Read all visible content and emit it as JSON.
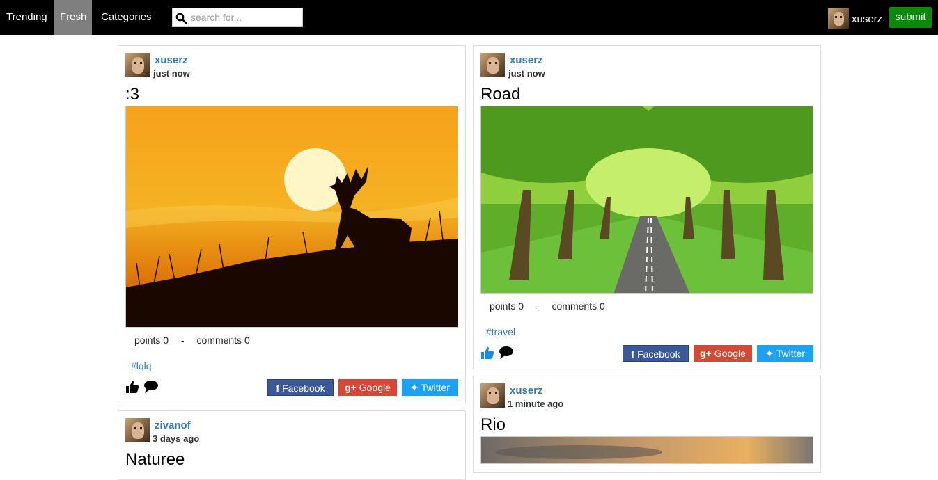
{
  "nav": {
    "items": [
      "Trending",
      "Fresh",
      "Categories"
    ],
    "active": "Fresh"
  },
  "search": {
    "placeholder": "search for..."
  },
  "user": {
    "name": "xuserz"
  },
  "submit_label": "submit",
  "posts": [
    {
      "author": "xuserz",
      "time": "just now",
      "title": ":3",
      "points_label": "points 0",
      "separator": "-",
      "comments_label": "comments 0",
      "tag": "#lqlq",
      "image": "deer-sunset"
    },
    {
      "author": "xuserz",
      "time": "just now",
      "title": "Road",
      "points_label": "points 0",
      "separator": "-",
      "comments_label": "comments 0",
      "tag": "#travel",
      "image": "tree-road"
    },
    {
      "author": "zivanof",
      "time": "3 days ago",
      "title": "Naturee",
      "image": ""
    },
    {
      "author": "xuserz",
      "time": "1 minute ago",
      "title": "Rio",
      "image": "sunset-clouds"
    }
  ],
  "share": {
    "facebook": "Facebook",
    "google": "Google",
    "twitter": "Twitter"
  },
  "colors": {
    "topbar": "#000000",
    "active_tab": "#7f7f7f",
    "submit": "#0a8a0a",
    "link": "#337ab7",
    "facebook": "#3b5998",
    "google": "#d34836",
    "twitter": "#1da1f2"
  }
}
